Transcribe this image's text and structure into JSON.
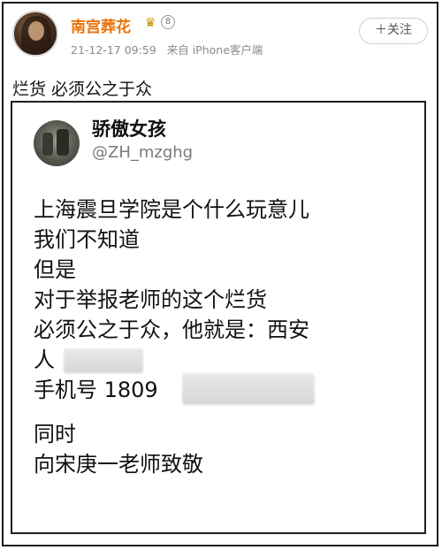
{
  "post": {
    "username": "南宫葬花",
    "crown_icon": "crown-icon",
    "level_icon": "level-badge-icon",
    "level_text": "8",
    "timestamp": "21-12-17 09:59",
    "source": "来自 iPhone客户端",
    "follow_label": "＋关注",
    "text": "烂货 必须公之于众"
  },
  "card": {
    "name": "骄傲女孩",
    "handle": "@ZH_mzghg",
    "lines": [
      "上海震旦学院是个什么玩意儿",
      "我们不知道",
      "但是",
      "对于举报老师的这个烂货",
      "必须公之于众，他就是：西安",
      "人",
      "手机号 1809",
      "同时",
      "向宋庚一老师致敬"
    ]
  },
  "colors": {
    "username": "#e8730a",
    "meta": "#8a8a8a",
    "handle": "#7a7a7a"
  }
}
